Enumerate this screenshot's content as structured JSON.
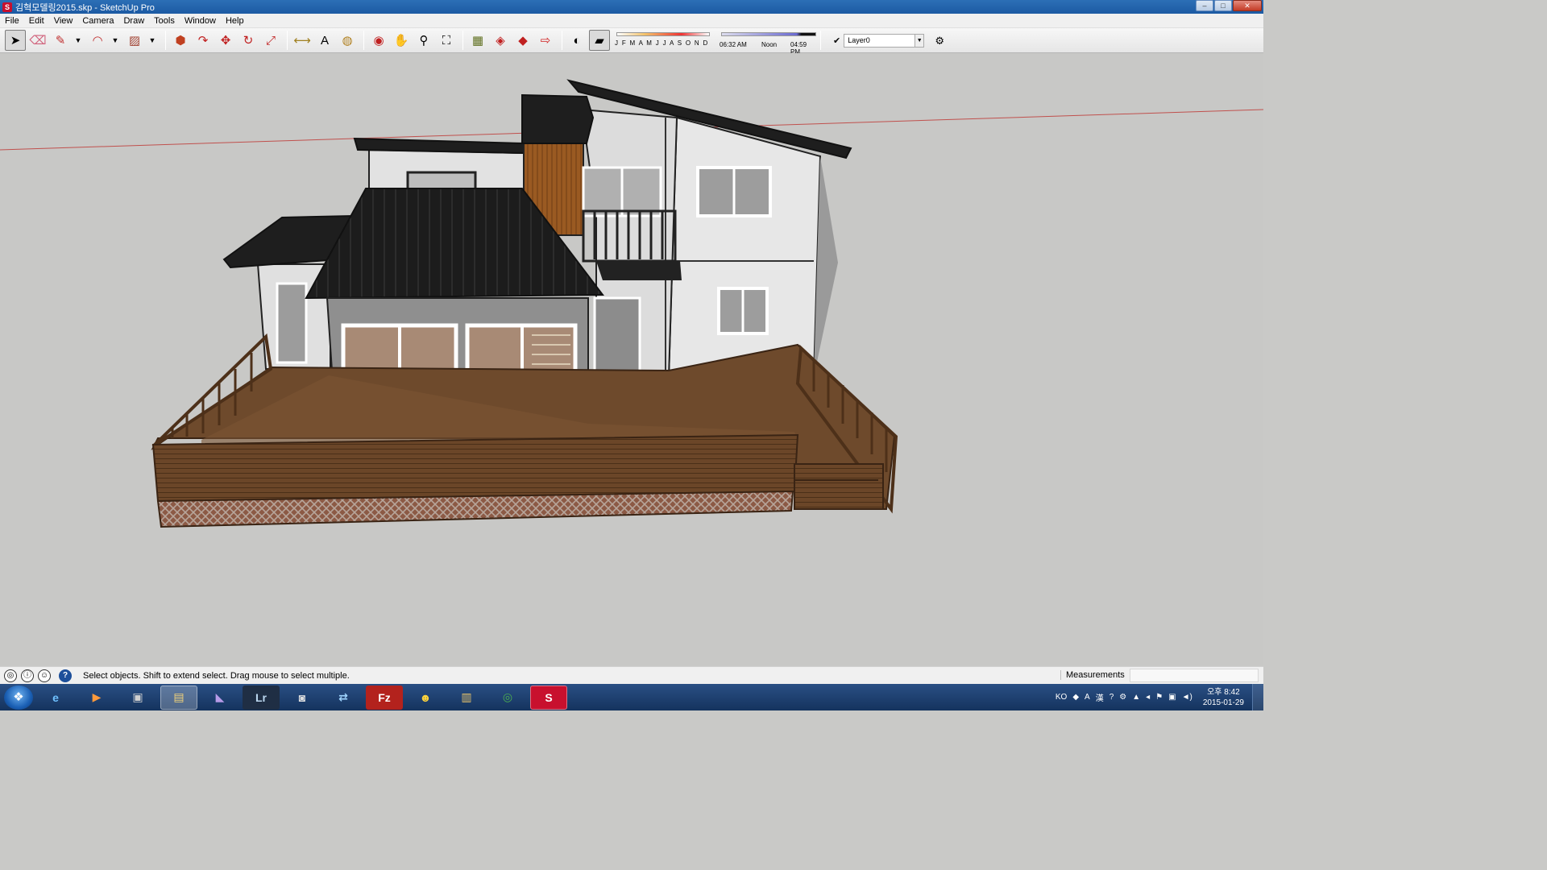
{
  "window": {
    "title": "김혁모델링2015.skp - SketchUp Pro",
    "app_icon": "sketchup-icon"
  },
  "window_controls": {
    "minimize": "–",
    "maximize": "□",
    "close": "✕"
  },
  "menu": [
    "File",
    "Edit",
    "View",
    "Camera",
    "Draw",
    "Tools",
    "Window",
    "Help"
  ],
  "toolbar": {
    "tools": [
      {
        "name": "select",
        "glyph": "➤"
      },
      {
        "name": "eraser",
        "glyph": "⌫"
      },
      {
        "name": "pencil",
        "glyph": "✎"
      },
      {
        "name": "arc",
        "glyph": "◠"
      },
      {
        "name": "rectangle",
        "glyph": "▨"
      },
      {
        "name": "push-pull",
        "glyph": "⬢"
      },
      {
        "name": "follow-me",
        "glyph": "↷"
      },
      {
        "name": "move",
        "glyph": "✥"
      },
      {
        "name": "rotate",
        "glyph": "↻"
      },
      {
        "name": "scale",
        "glyph": "⤢"
      },
      {
        "name": "tape-measure",
        "glyph": "⟷"
      },
      {
        "name": "text",
        "glyph": "A"
      },
      {
        "name": "paint-bucket",
        "glyph": "◍"
      },
      {
        "name": "orbit",
        "glyph": "◉"
      },
      {
        "name": "pan",
        "glyph": "✋"
      },
      {
        "name": "zoom",
        "glyph": "⚲"
      },
      {
        "name": "zoom-extents",
        "glyph": "⛶"
      },
      {
        "name": "warehouse",
        "glyph": "▦"
      },
      {
        "name": "get-models",
        "glyph": "◈"
      },
      {
        "name": "share-model",
        "glyph": "◆"
      },
      {
        "name": "send-to-layout",
        "glyph": "⇨"
      },
      {
        "name": "shadows",
        "glyph": "◐"
      },
      {
        "name": "fog",
        "glyph": "▰"
      }
    ],
    "shadow_months": "J F M A M J J A S O N D",
    "shadow_time_start": "06:32 AM",
    "shadow_time_noon": "Noon",
    "shadow_time_end": "04:59 PM",
    "layer_current": "Layer0"
  },
  "status": {
    "hint": "Select objects. Shift to extend select. Drag mouse to select multiple.",
    "measurements_label": "Measurements",
    "measurements_value": ""
  },
  "taskbar": {
    "items": [
      {
        "name": "internet-explorer",
        "glyph": "e"
      },
      {
        "name": "media-player",
        "glyph": "▶"
      },
      {
        "name": "film-app",
        "glyph": "▣"
      },
      {
        "name": "file-explorer",
        "glyph": "▤"
      },
      {
        "name": "visual-studio",
        "glyph": "◣"
      },
      {
        "name": "lightroom",
        "glyph": "Lr"
      },
      {
        "name": "camera-app",
        "glyph": "◙"
      },
      {
        "name": "network-app",
        "glyph": "⇄"
      },
      {
        "name": "filezilla",
        "glyph": "Fz"
      },
      {
        "name": "qq-messenger",
        "glyph": "☻"
      },
      {
        "name": "archive-app",
        "glyph": "▥"
      },
      {
        "name": "chrome",
        "glyph": "◎"
      },
      {
        "name": "sketchup",
        "glyph": "S"
      }
    ],
    "tray_lang": "KO",
    "tray_ime_a": "A",
    "tray_ime_han": "漢",
    "clock_time": "오후 8:42",
    "clock_date": "2015-01-29"
  },
  "colors": {
    "roof": "#1e1e1e",
    "wall": "#e6e6e6",
    "deck": "#6e4a2c",
    "deck_dark": "#4d3019",
    "wood_accent": "#9a5a22",
    "horizon": "#c0504d"
  }
}
